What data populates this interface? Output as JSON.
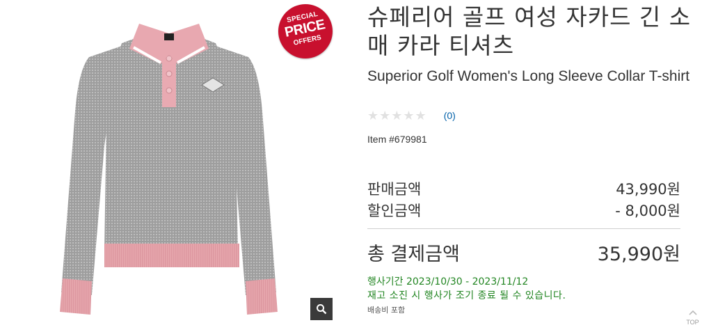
{
  "badge": {
    "line1": "SPECIAL",
    "line2": "PRICE",
    "line3": "OFFERS"
  },
  "product": {
    "title_ko": "슈페리어 골프 여성 자카드 긴 소매 카라 티셔츠",
    "title_en": "Superior Golf Women's Long Sleeve Collar T-shirt",
    "rating_count": "(0)",
    "rating_stars": "★★★★★",
    "item_number": "Item #679981"
  },
  "pricing": {
    "sale_label": "판매금액",
    "sale_value": "43,990원",
    "discount_label": "할인금액",
    "discount_value": "- 8,000원",
    "total_label": "총 결제금액",
    "total_value": "35,990원"
  },
  "promo": {
    "event_period": "행사기간 2023/10/30 - 2023/11/12",
    "stock_note": "재고 소진 시 행사가 조기 종료 될 수 있습니다.",
    "shipping_note": "배송비 포함"
  },
  "nav": {
    "top_label": "TOP"
  },
  "colors": {
    "accent_green": "#218521",
    "link_blue": "#0060a9",
    "badge_red": "#c8102e",
    "shirt_gray": "#a8a8a8",
    "shirt_pink": "#e8aab0"
  }
}
